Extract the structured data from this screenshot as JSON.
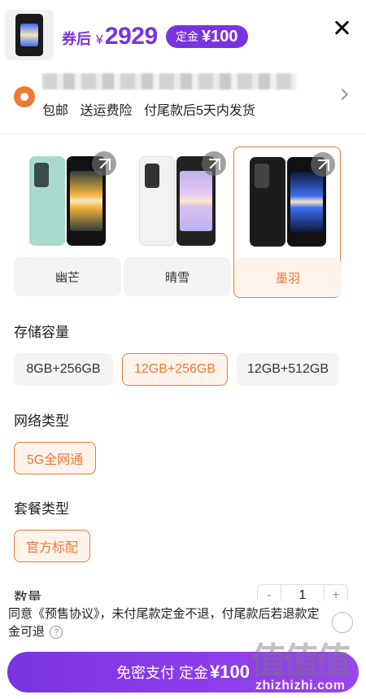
{
  "header": {
    "after_coupon_label": "券后",
    "currency_symbol": "¥",
    "price": "2929",
    "deposit_label": "定金",
    "deposit_amount": "¥100",
    "close_icon": "close-icon",
    "product_thumb_icon": "phone-thumbnail"
  },
  "address": {
    "pin_icon": "location-pin-icon",
    "shipping_tags": [
      "包邮",
      "送运费险",
      "付尾款后5天内发货"
    ],
    "chevron_icon": "chevron-right-icon"
  },
  "colors": {
    "items": [
      {
        "label": "幽芒",
        "selected": false,
        "body_color": "#a9d9cf"
      },
      {
        "label": "晴雪",
        "selected": false,
        "body_color": "#f2f2f2"
      },
      {
        "label": "墨羽",
        "selected": true,
        "body_color": "#1c1c1c"
      }
    ],
    "expand_icon": "expand-icon"
  },
  "storage": {
    "title": "存储容量",
    "options": [
      {
        "label": "8GB+256GB",
        "selected": false
      },
      {
        "label": "12GB+256GB",
        "selected": true
      },
      {
        "label": "12GB+512GB",
        "selected": false
      }
    ]
  },
  "network": {
    "title": "网络类型",
    "options": [
      {
        "label": "5G全网通",
        "selected": true
      }
    ]
  },
  "package": {
    "title": "套餐类型",
    "options": [
      {
        "label": "官方标配",
        "selected": true
      }
    ]
  },
  "quantity": {
    "title": "数量",
    "minus": "-",
    "value": "1",
    "plus": "+"
  },
  "agreement": {
    "text": "同意《预售协议》，未付尾款定金不退，付尾款后若退款定金可退",
    "help_glyph": "?"
  },
  "pay_button": {
    "label": "免密支付 定金",
    "amount": "¥100"
  },
  "watermark": {
    "logo_text": "值值值",
    "site": "zhizhizhi.com"
  },
  "theme": {
    "accent_purple": "#7a33e0",
    "accent_orange": "#f07834"
  }
}
